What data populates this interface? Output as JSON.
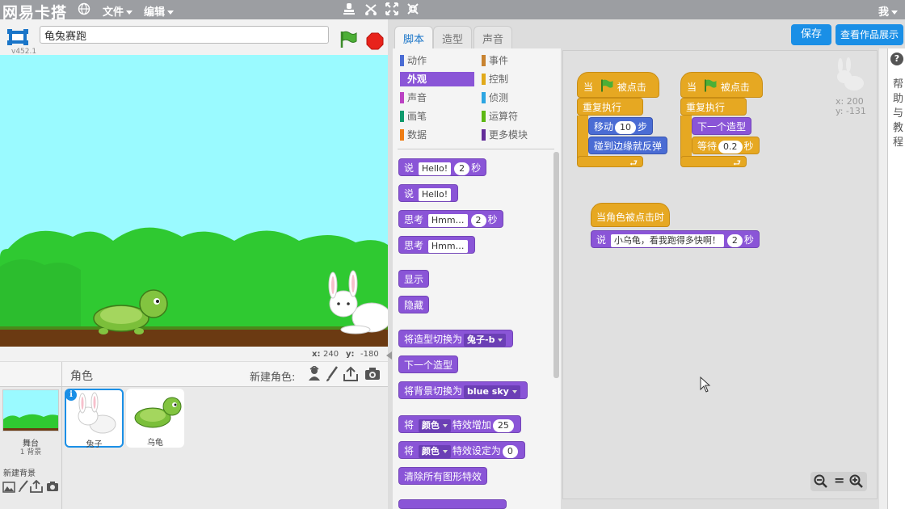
{
  "menubar": {
    "logo": "网易卡搭",
    "file_label": "文件",
    "edit_label": "编辑",
    "user_label": "我"
  },
  "stage_header": {
    "version": "v452.1",
    "project_title": "龟兔赛跑"
  },
  "stage_coords": {
    "x_label": "x:",
    "x_value": "240",
    "y_label": "y:",
    "y_value": "-180"
  },
  "sprites_panel": {
    "title": "角色",
    "new_sprite_label": "新建角色:",
    "stage_thumb_label": "舞台",
    "stage_thumb_sub": "1 背景",
    "new_backdrop_label": "新建背景",
    "sprites": [
      {
        "name": "兔子",
        "selected": true
      },
      {
        "name": "乌龟",
        "selected": false
      }
    ]
  },
  "tabs": [
    {
      "label": "脚本",
      "active": true
    },
    {
      "label": "造型",
      "active": false
    },
    {
      "label": "声音",
      "active": false
    }
  ],
  "categories_left": [
    {
      "label": "动作",
      "color": "#4a6cd4",
      "active": false
    },
    {
      "label": "外观",
      "color": "#8a55d7",
      "active": true
    },
    {
      "label": "声音",
      "color": "#bb42c3",
      "active": false
    },
    {
      "label": "画笔",
      "color": "#0e9a6c",
      "active": false
    },
    {
      "label": "数据",
      "color": "#ee7d16",
      "active": false
    }
  ],
  "categories_right": [
    {
      "label": "事件",
      "color": "#c88330",
      "active": false
    },
    {
      "label": "控制",
      "color": "#e1a91a",
      "active": false
    },
    {
      "label": "侦测",
      "color": "#2ca5e2",
      "active": false
    },
    {
      "label": "运算符",
      "color": "#5cb712",
      "active": false
    },
    {
      "label": "更多模块",
      "color": "#632d99",
      "active": false
    }
  ],
  "palette_blocks": {
    "say_secs": {
      "say": "说",
      "text": "Hello!",
      "num": "2",
      "unit": "秒"
    },
    "say": {
      "say": "说",
      "text": "Hello!"
    },
    "think_secs": {
      "think": "思考",
      "text": "Hmm…",
      "num": "2",
      "unit": "秒"
    },
    "think": {
      "think": "思考",
      "text": "Hmm…"
    },
    "show": "显示",
    "hide": "隐藏",
    "switch_costume": {
      "label": "将造型切换为",
      "value": "兔子-b"
    },
    "next_costume": "下一个造型",
    "switch_backdrop": {
      "label": "将背景切换为",
      "value": "blue sky"
    },
    "change_effect": {
      "pre": "将",
      "effect": "颜色",
      "label": "特效增加",
      "num": "25"
    },
    "set_effect": {
      "pre": "将",
      "effect": "颜色",
      "label": "特效设定为",
      "num": "0"
    },
    "clear_effects": "清除所有图形特效"
  },
  "toolbar": {
    "save_label": "保存",
    "view_project_label": "查看作品展示"
  },
  "sprite_info": {
    "x_label": "x:",
    "x_value": "200",
    "y_label": "y:",
    "y_value": "-131"
  },
  "scripts": {
    "script1": {
      "hat_when": "当",
      "hat_clicked": "被点击",
      "forever": "重复执行",
      "move": "移动",
      "move_num": "10",
      "move_unit": "步",
      "bounce": "碰到边缘就反弹"
    },
    "script2": {
      "hat_when": "当",
      "hat_clicked": "被点击",
      "forever": "重复执行",
      "next_costume": "下一个造型",
      "wait": "等待",
      "wait_num": "0.2",
      "wait_unit": "秒"
    },
    "script3": {
      "hat": "当角色被点击时",
      "say": "说",
      "text": "小乌龟，看我跑得多快啊！",
      "num": "2",
      "unit": "秒"
    }
  },
  "help_panel": {
    "text": "帮助与教程"
  },
  "zoom": {
    "reset_label": "="
  }
}
